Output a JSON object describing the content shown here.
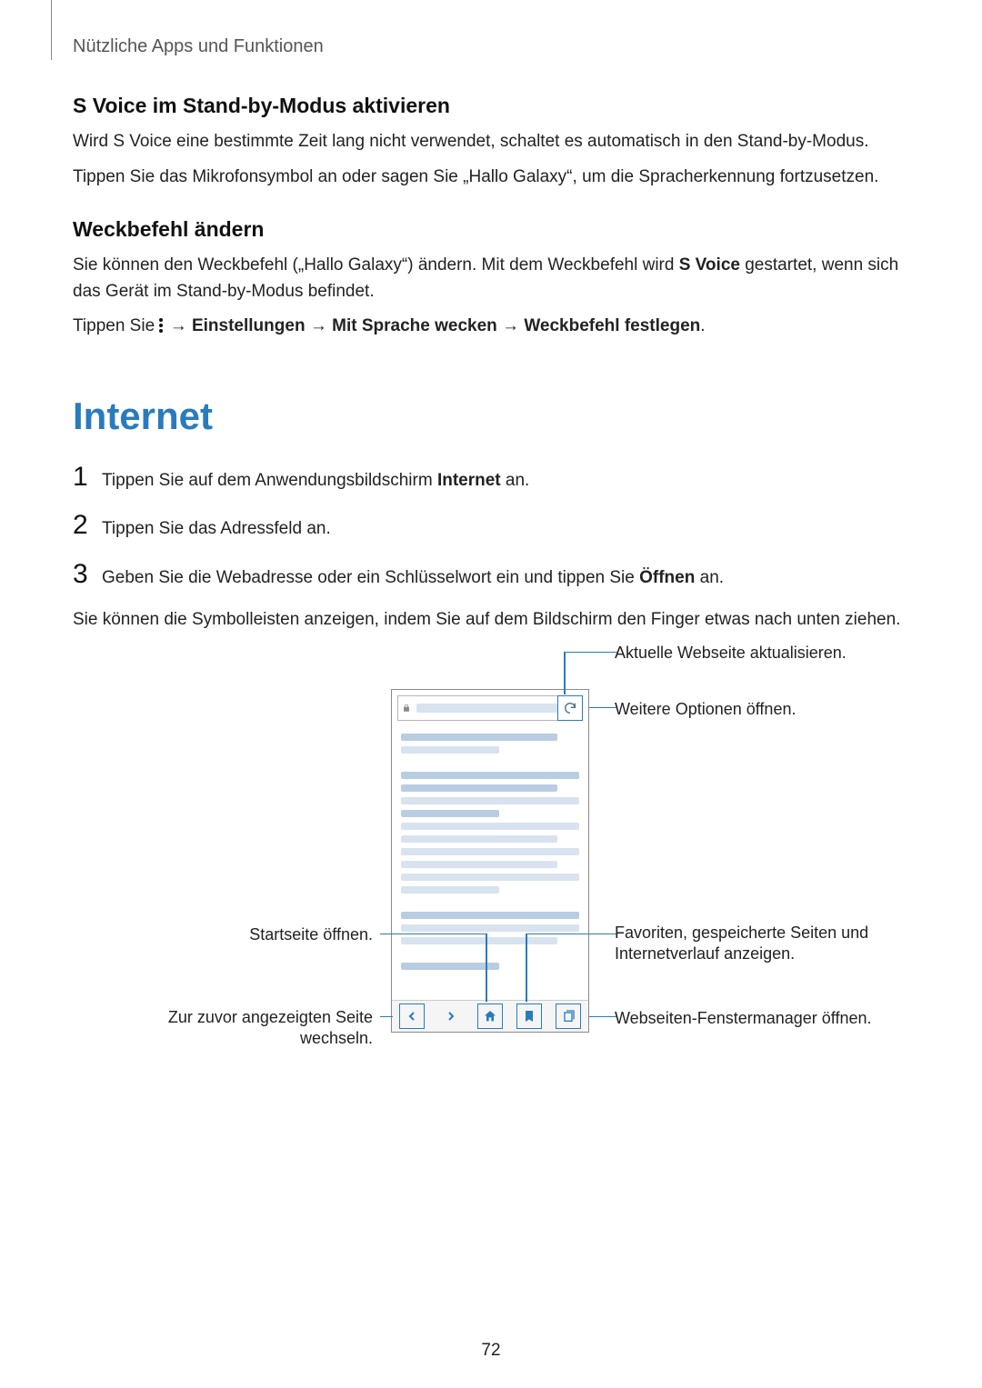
{
  "breadcrumb": "Nützliche Apps und Funktionen",
  "section1": {
    "heading": "S Voice im Stand-by-Modus aktivieren",
    "p1": "Wird S Voice eine bestimmte Zeit lang nicht verwendet, schaltet es automatisch in den Stand-by-Modus.",
    "p2": "Tippen Sie das Mikrofonsymbol an oder sagen Sie „Hallo Galaxy“, um die Spracherkennung fortzusetzen."
  },
  "section2": {
    "heading": "Weckbefehl ändern",
    "p1a": "Sie können den Weckbefehl („Hallo Galaxy“) ändern. Mit dem Weckbefehl wird ",
    "p1b_bold": "S Voice",
    "p1c": " gestartet, wenn sich das Gerät im Stand-by-Modus befindet.",
    "p2a": "Tippen Sie ",
    "p2_arrow1": " → ",
    "p2_b1": "Einstellungen",
    "p2_arrow2": " → ",
    "p2_b2": "Mit Sprache wecken",
    "p2_arrow3": " → ",
    "p2_b3": "Weckbefehl festlegen",
    "p2_end": "."
  },
  "major_heading": "Internet",
  "steps": {
    "s1a": "Tippen Sie auf dem Anwendungsbildschirm ",
    "s1b_bold": "Internet",
    "s1c": " an.",
    "s2": "Tippen Sie das Adressfeld an.",
    "s3a": "Geben Sie die Webadresse oder ein Schlüsselwort ein und tippen Sie ",
    "s3b_bold": "Öffnen",
    "s3c": " an."
  },
  "after_steps": "Sie können die Symbolleisten anzeigen, indem Sie auf dem Bildschirm den Finger etwas nach unten ziehen.",
  "callouts": {
    "refresh": "Aktuelle Webseite aktualisieren.",
    "more_options": "Weitere Optionen öffnen.",
    "home": "Startseite öffnen.",
    "back": "Zur zuvor angezeigten Seite wechseln.",
    "bookmarks": "Favoriten, gespeicherte Seiten und Internetverlauf anzeigen.",
    "tabs": "Webseiten-Fenstermanager öffnen."
  },
  "page_number": "72"
}
